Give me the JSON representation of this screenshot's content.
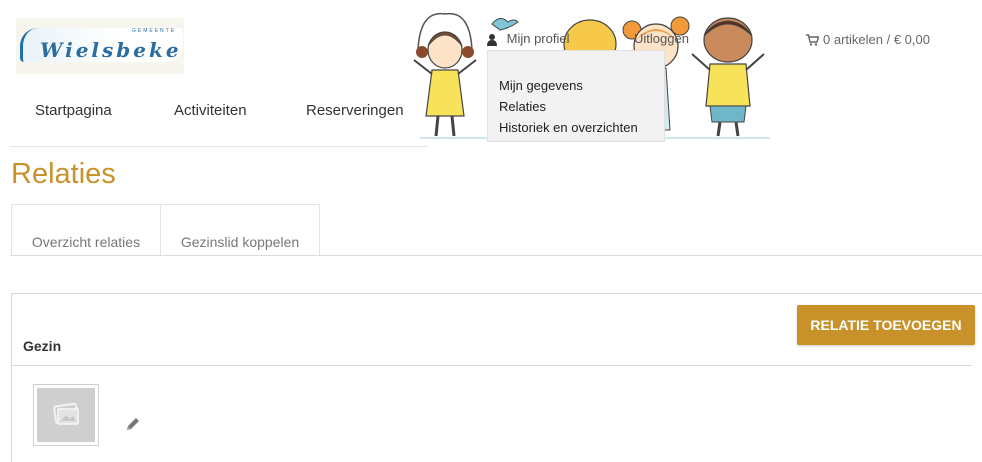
{
  "logo": {
    "small_text": "GEMEENTE",
    "name": "Wielsbeke"
  },
  "nav": {
    "items": [
      "Startpagina",
      "Activiteiten",
      "Reserveringen"
    ]
  },
  "user_menu": {
    "profile_label": "Mijn profiel",
    "logout_label": "Uitloggen",
    "dropdown": [
      "Mijn gegevens",
      "Relaties",
      "Historiek en overzichten"
    ]
  },
  "cart": {
    "label": "0 artikelen / € 0,00",
    "icon": "cart-icon"
  },
  "page": {
    "title": "Relaties"
  },
  "tabs": [
    "Overzicht relaties",
    "Gezinslid koppelen"
  ],
  "panel": {
    "title": "Gezin",
    "add_button": "RELATIE TOEVOEGEN"
  },
  "colors": {
    "accent": "#c8912a",
    "logo_blue": "#2a6da3"
  }
}
